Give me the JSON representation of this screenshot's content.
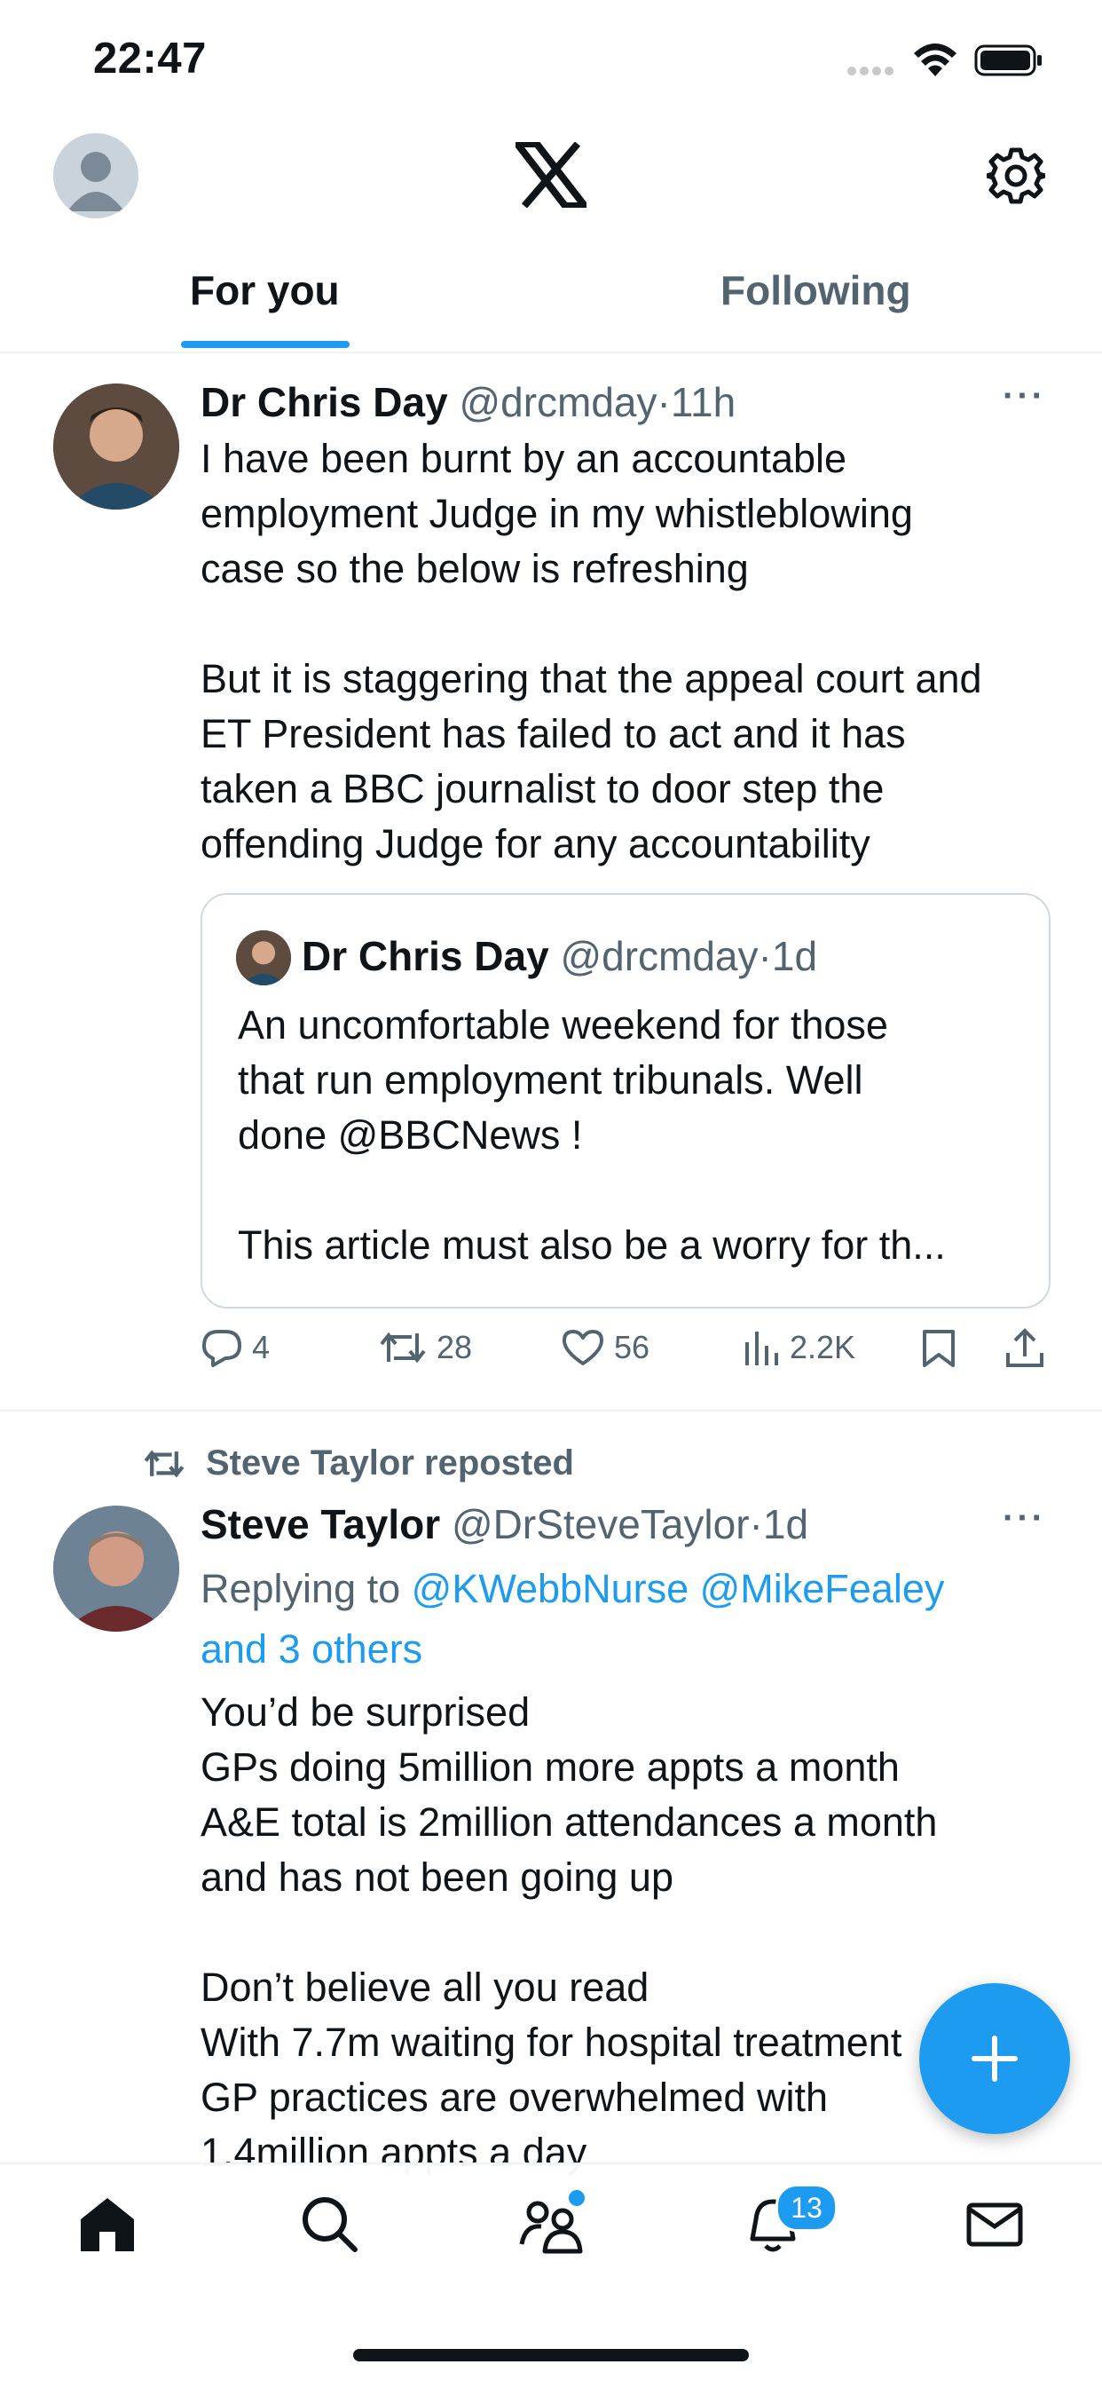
{
  "status_bar": {
    "time": "22:47"
  },
  "tabs": [
    {
      "label": "For you",
      "selected": true
    },
    {
      "label": "Following",
      "selected": false
    }
  ],
  "tweet1": {
    "name": "Dr Chris Day",
    "handle": "@drcmday",
    "time": "11h",
    "more": "···",
    "text": "I have been burnt by an accountable\nemployment Judge in my whistleblowing\ncase so the below is refreshing\n\nBut it is staggering that the appeal court and\nET President has failed to act and it has\ntaken a BBC journalist to door step the\noffending Judge for any accountability",
    "quote": {
      "name": "Dr Chris Day",
      "handle": "@drcmday",
      "time": "1d",
      "text": "An uncomfortable weekend for those\nthat run employment tribunals. Well\ndone @BBCNews !\n\nThis article must also be a worry for th..."
    },
    "actions": {
      "replies": "4",
      "reposts": "28",
      "likes": "56",
      "views": "2.2K"
    }
  },
  "tweet2": {
    "reposted_by": "Steve Taylor reposted",
    "name": "Steve Taylor",
    "handle": "@DrSteveTaylor",
    "time": "1d",
    "more": "···",
    "replying_prefix": "Replying to ",
    "replying_to": "@KWebbNurse @MikeFealey\nand 3 others",
    "text": "You’d be surprised\nGPs doing 5million more appts a month\nA&E total is 2million attendances a month\nand has not been going up\n\nDon’t believe all you read\nWith 7.7m waiting for hospital treatment\nGP practices are overwhelmed with\n1.4million appts a day"
  },
  "nav": {
    "items": [
      "home-icon",
      "search-icon",
      "communities-icon",
      "notifications-icon",
      "messages-icon"
    ],
    "notification_count": "13"
  },
  "colors": {
    "accent": "#1d9bf0",
    "text": "#0f1419",
    "secondary": "#536471"
  }
}
